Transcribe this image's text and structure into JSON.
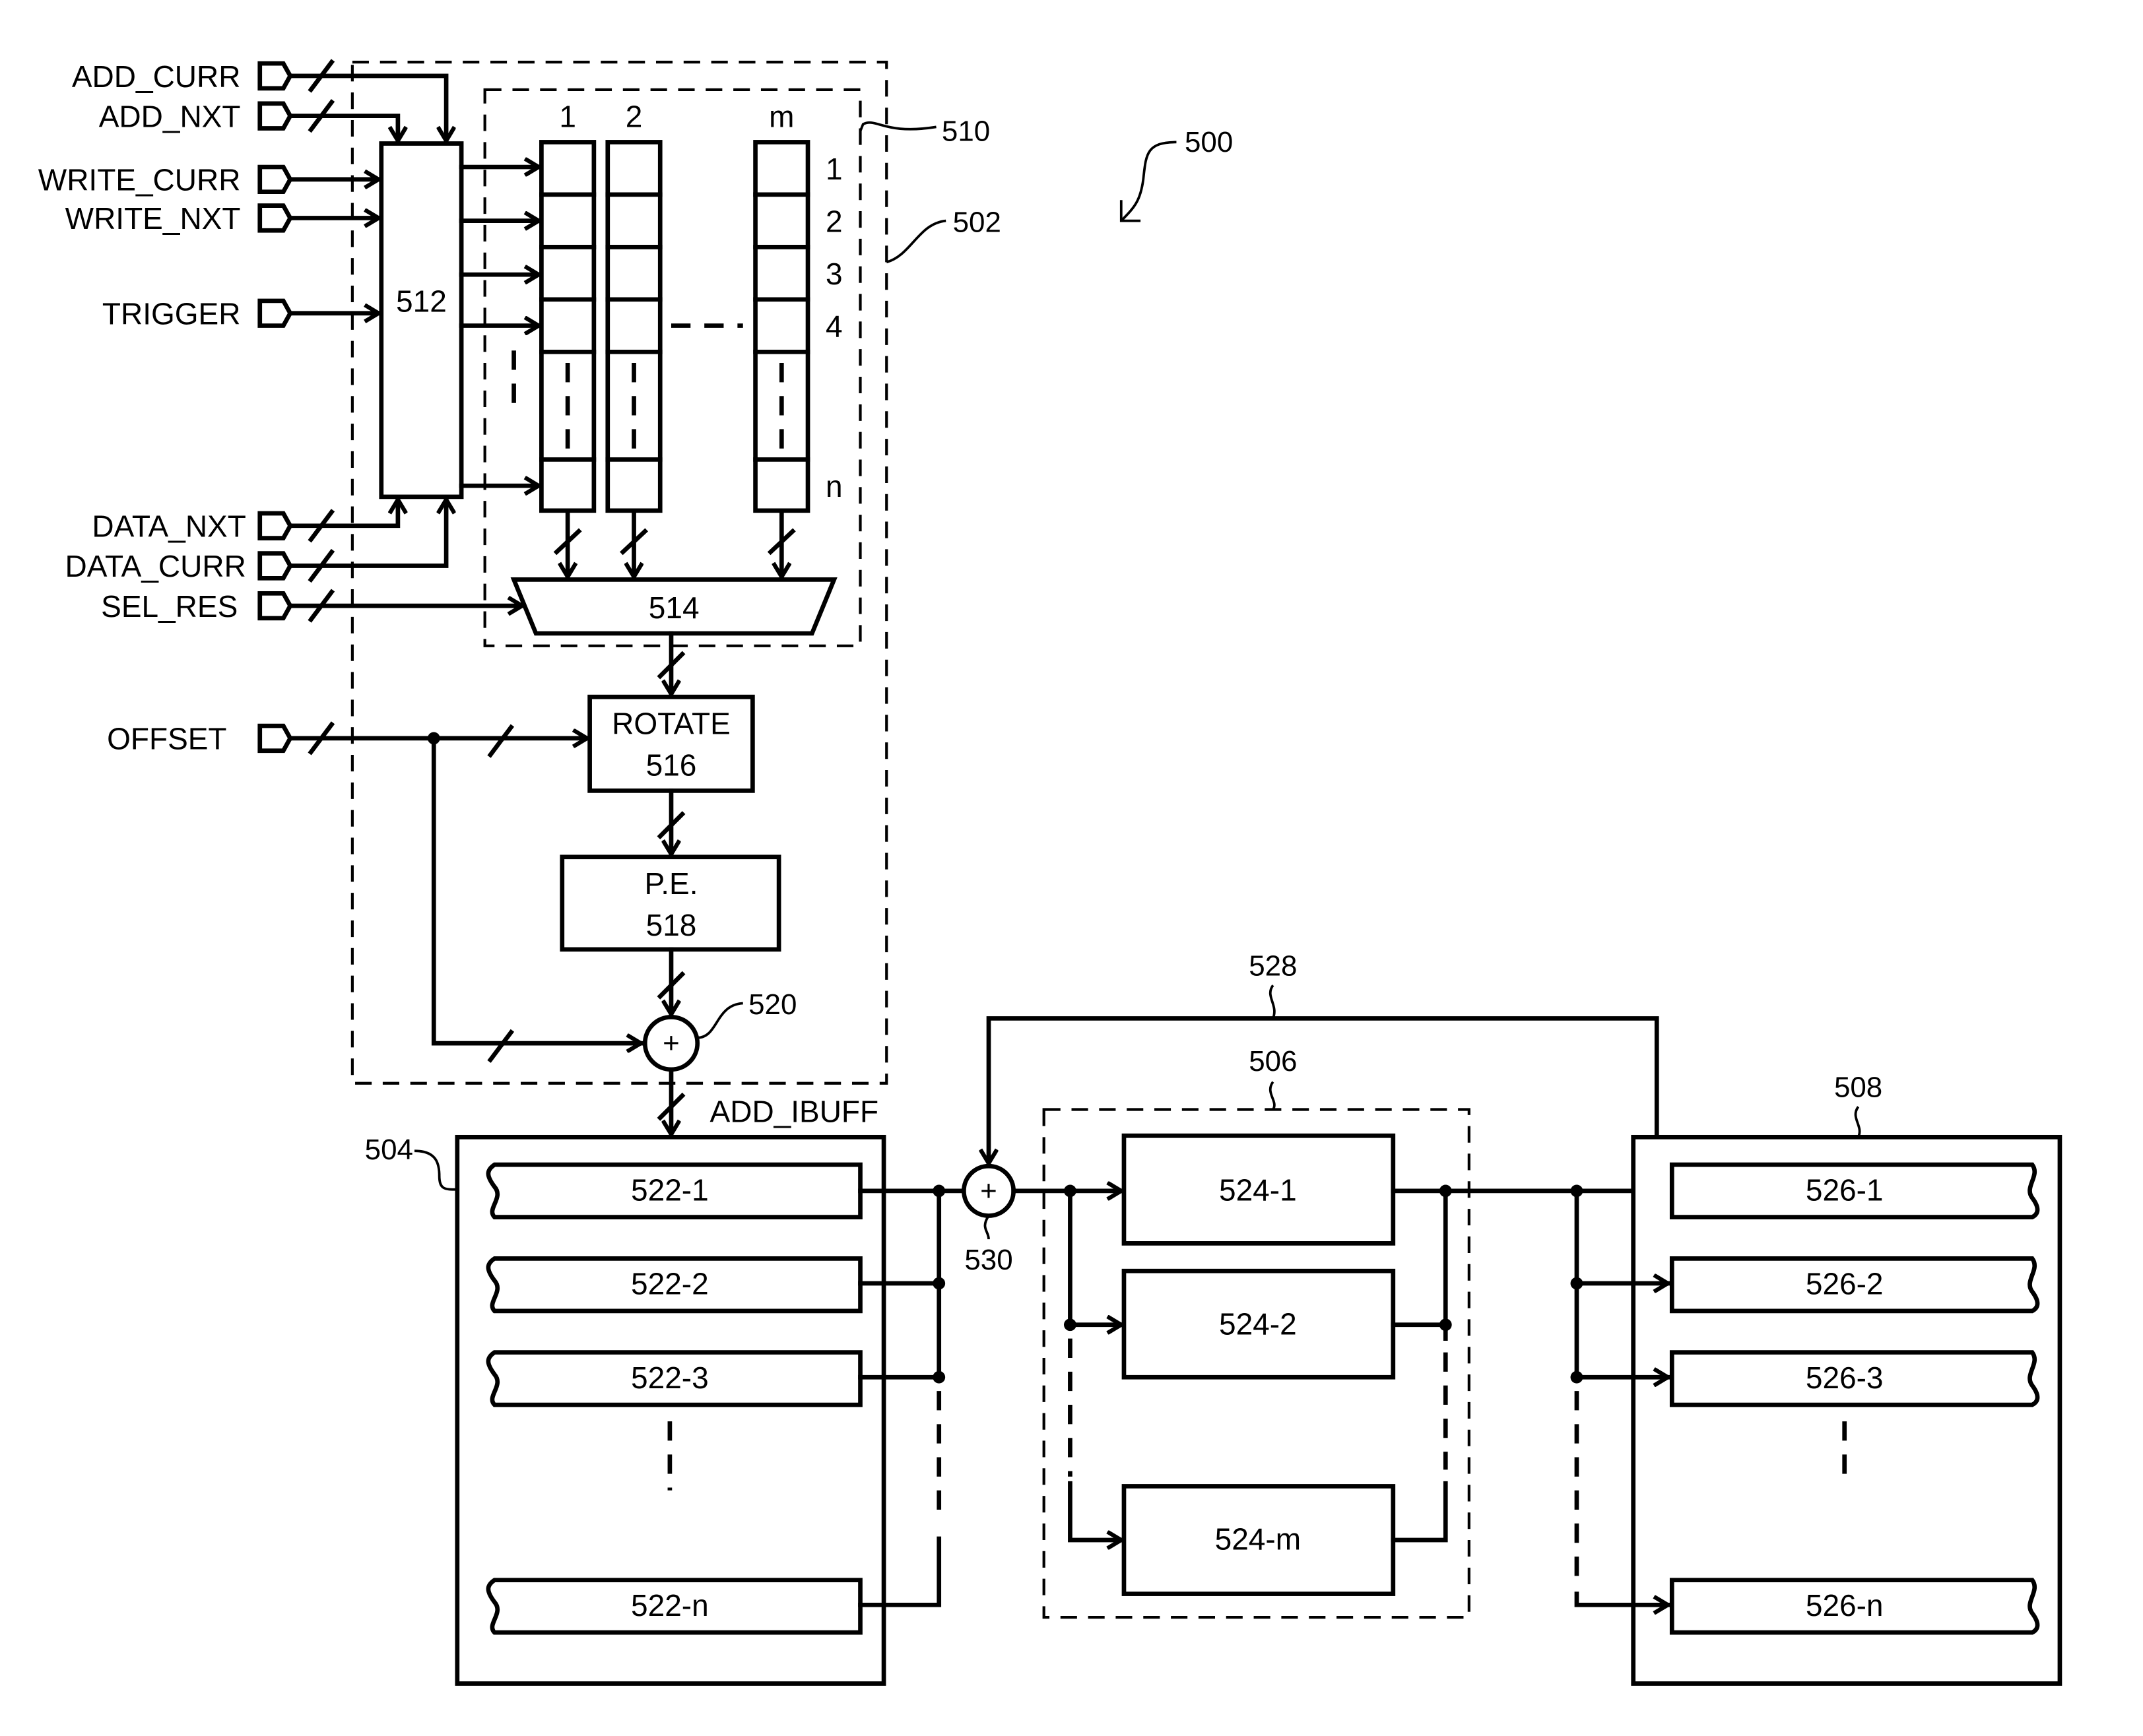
{
  "figure": {
    "ref_main": "500",
    "ref_502": "502",
    "ref_510": "510",
    "ref_504": "504",
    "ref_506": "506",
    "ref_508": "508",
    "ref_520": "520",
    "ref_528": "528",
    "ref_530": "530"
  },
  "inputs": [
    {
      "label": "ADD_CURR"
    },
    {
      "label": "ADD_NXT"
    },
    {
      "label": "WRITE_CURR"
    },
    {
      "label": "WRITE_NXT"
    },
    {
      "label": "TRIGGER"
    },
    {
      "label": "DATA_NXT"
    },
    {
      "label": "DATA_CURR"
    },
    {
      "label": "SEL_RES"
    },
    {
      "label": "OFFSET"
    }
  ],
  "blocks": {
    "controller": "512",
    "mux": "514",
    "rotate_title": "ROTATE",
    "rotate_num": "516",
    "pe_title": "P.E.",
    "pe_num": "518",
    "adder_symbol": "+",
    "add_ibuff": "ADD_IBUFF"
  },
  "memory_array": {
    "columns": [
      "1",
      "2",
      "m"
    ],
    "rows": [
      "1",
      "2",
      "3",
      "4",
      "n"
    ]
  },
  "buffer_504": [
    "522-1",
    "522-2",
    "522-3",
    "522-n"
  ],
  "units_506": [
    "524-1",
    "524-2",
    "524-m"
  ],
  "buffer_508": [
    "526-1",
    "526-2",
    "526-3",
    "526-n"
  ]
}
